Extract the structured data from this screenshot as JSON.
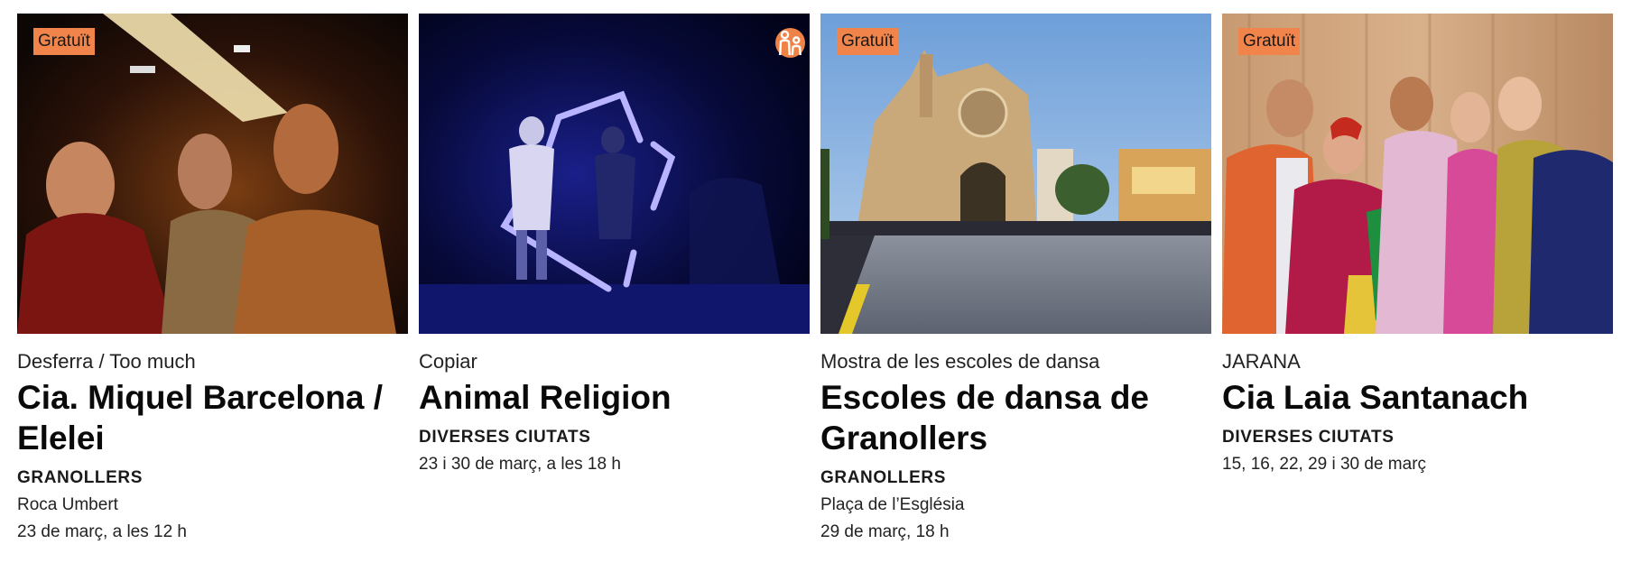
{
  "cards": [
    {
      "badge": "Gratuït",
      "kicker": "Desferra / Too much",
      "title": "Cia. Miquel Barcelona / Elelei",
      "city": "GRANOLLERS",
      "venue": "Roca Umbert",
      "date": "23 de març, a les 12 h",
      "image": "photo-three-dancers-dark-stage"
    },
    {
      "icon": "family-icon",
      "kicker": "Copiar",
      "title": "Animal Religion",
      "city": "DIVERSES CIUTATS",
      "date": "23 i 30 de març, a les 18 h",
      "image": "photo-neon-frame-performers-blue"
    },
    {
      "badge": "Gratuït",
      "kicker": "Mostra de les escoles de dansa",
      "title": "Escoles de dansa de Granollers",
      "city": "GRANOLLERS",
      "venue": "Plaça de l’Església",
      "date": "29 de març, 18 h",
      "image": "photo-church-square-crowd"
    },
    {
      "badge": "Gratuït",
      "kicker": "JARANA",
      "title": "Cia Laia Santanach",
      "city": "DIVERSES CIUTATS",
      "date": "15, 16, 22, 29 i 30 de març",
      "image": "photo-colourful-group-portrait"
    }
  ],
  "colors": {
    "badge": "#f0844a",
    "text": "#111111",
    "background": "#ffffff"
  }
}
